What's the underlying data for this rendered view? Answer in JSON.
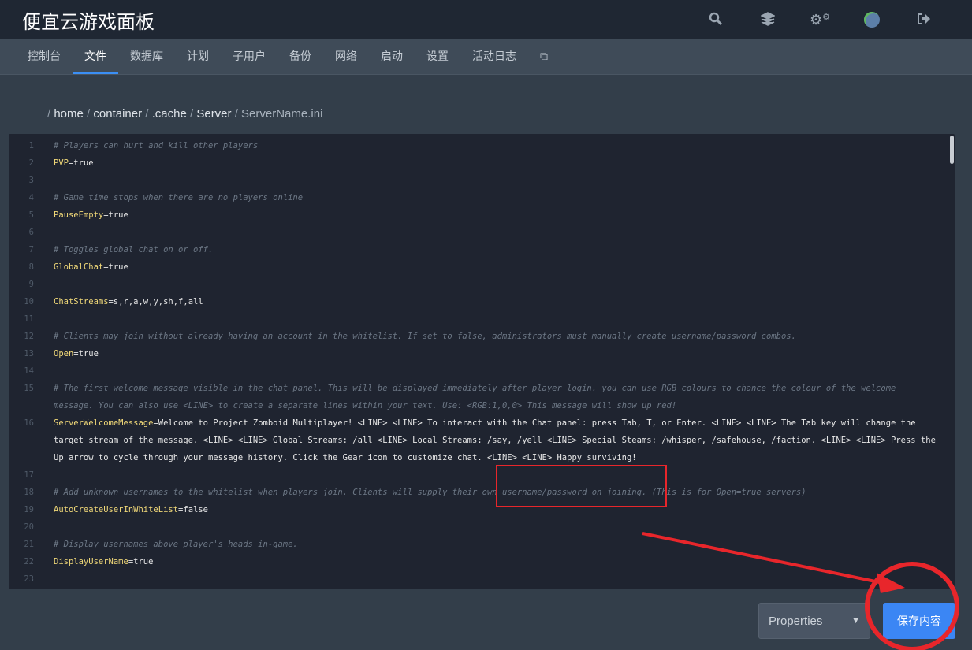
{
  "app": {
    "title": "便宜云游戏面板"
  },
  "header_icons": [
    "search-icon",
    "layers-icon",
    "cogs-icon",
    "avatar",
    "sign-out-icon"
  ],
  "nav": {
    "tabs": [
      {
        "label": "控制台"
      },
      {
        "label": "文件",
        "active": true
      },
      {
        "label": "数据库"
      },
      {
        "label": "计划"
      },
      {
        "label": "子用户"
      },
      {
        "label": "备份"
      },
      {
        "label": "网络"
      },
      {
        "label": "启动"
      },
      {
        "label": "设置"
      },
      {
        "label": "活动日志"
      }
    ],
    "external_icon": "external-link-icon"
  },
  "breadcrumb": {
    "sep": "/",
    "items": [
      "home",
      "container",
      ".cache",
      "Server"
    ],
    "current": "ServerName.ini"
  },
  "editor": {
    "lines": [
      {
        "n": "1",
        "comment": "# Players can hurt and kill other players"
      },
      {
        "n": "2",
        "key": "PVP",
        "value": "=true"
      },
      {
        "n": "3"
      },
      {
        "n": "4",
        "comment": "# Game time stops when there are no players online"
      },
      {
        "n": "5",
        "key": "PauseEmpty",
        "value": "=true"
      },
      {
        "n": "6"
      },
      {
        "n": "7",
        "comment": "# Toggles global chat on or off."
      },
      {
        "n": "8",
        "key": "GlobalChat",
        "value": "=true"
      },
      {
        "n": "9"
      },
      {
        "n": "10",
        "key": "ChatStreams",
        "value": "=s,r,a,w,y,sh,f,all"
      },
      {
        "n": "11"
      },
      {
        "n": "12",
        "comment": "# Clients may join without already having an account in the whitelist. If set to false, administrators must manually create username/password combos."
      },
      {
        "n": "13",
        "key": "Open",
        "value": "=true"
      },
      {
        "n": "14"
      },
      {
        "n": "15",
        "comment": "# The first welcome message visible in the chat panel. This will be displayed immediately after player login. you can use RGB colours to chance the colour of the welcome message. You can also use <LINE> to create a separate lines within your text. Use: <RGB:1,0,0> This message will show up red!"
      },
      {
        "n": "16",
        "key": "ServerWelcomeMessage",
        "value": "=Welcome to Project Zomboid Multiplayer! <LINE> <LINE> To interact with the Chat panel: press Tab, T, or Enter. <LINE> <LINE> The Tab key will change the target stream of the message. <LINE> <LINE> Global Streams: /all <LINE> Local Streams: /say, /yell <LINE> Special Steams: /whisper, /safehouse, /faction. <LINE> <LINE> Press the Up arrow to cycle through your message history. Click the Gear icon to customize chat. <LINE> <LINE> Happy surviving!"
      },
      {
        "n": "17"
      },
      {
        "n": "18",
        "comment": "# Add unknown usernames to the whitelist when players join. Clients will supply their own username/password on joining. (This is for Open=true servers)"
      },
      {
        "n": "19",
        "key": "AutoCreateUserInWhiteList",
        "value": "=false"
      },
      {
        "n": "20"
      },
      {
        "n": "21",
        "comment": "# Display usernames above player's heads in-game."
      },
      {
        "n": "22",
        "key": "DisplayUserName",
        "value": "=true"
      },
      {
        "n": "23"
      }
    ]
  },
  "footer": {
    "mode_select": "Properties",
    "save_label": "保存内容"
  },
  "colors": {
    "accent": "#3b86f4",
    "annotation": "#e8262b"
  }
}
